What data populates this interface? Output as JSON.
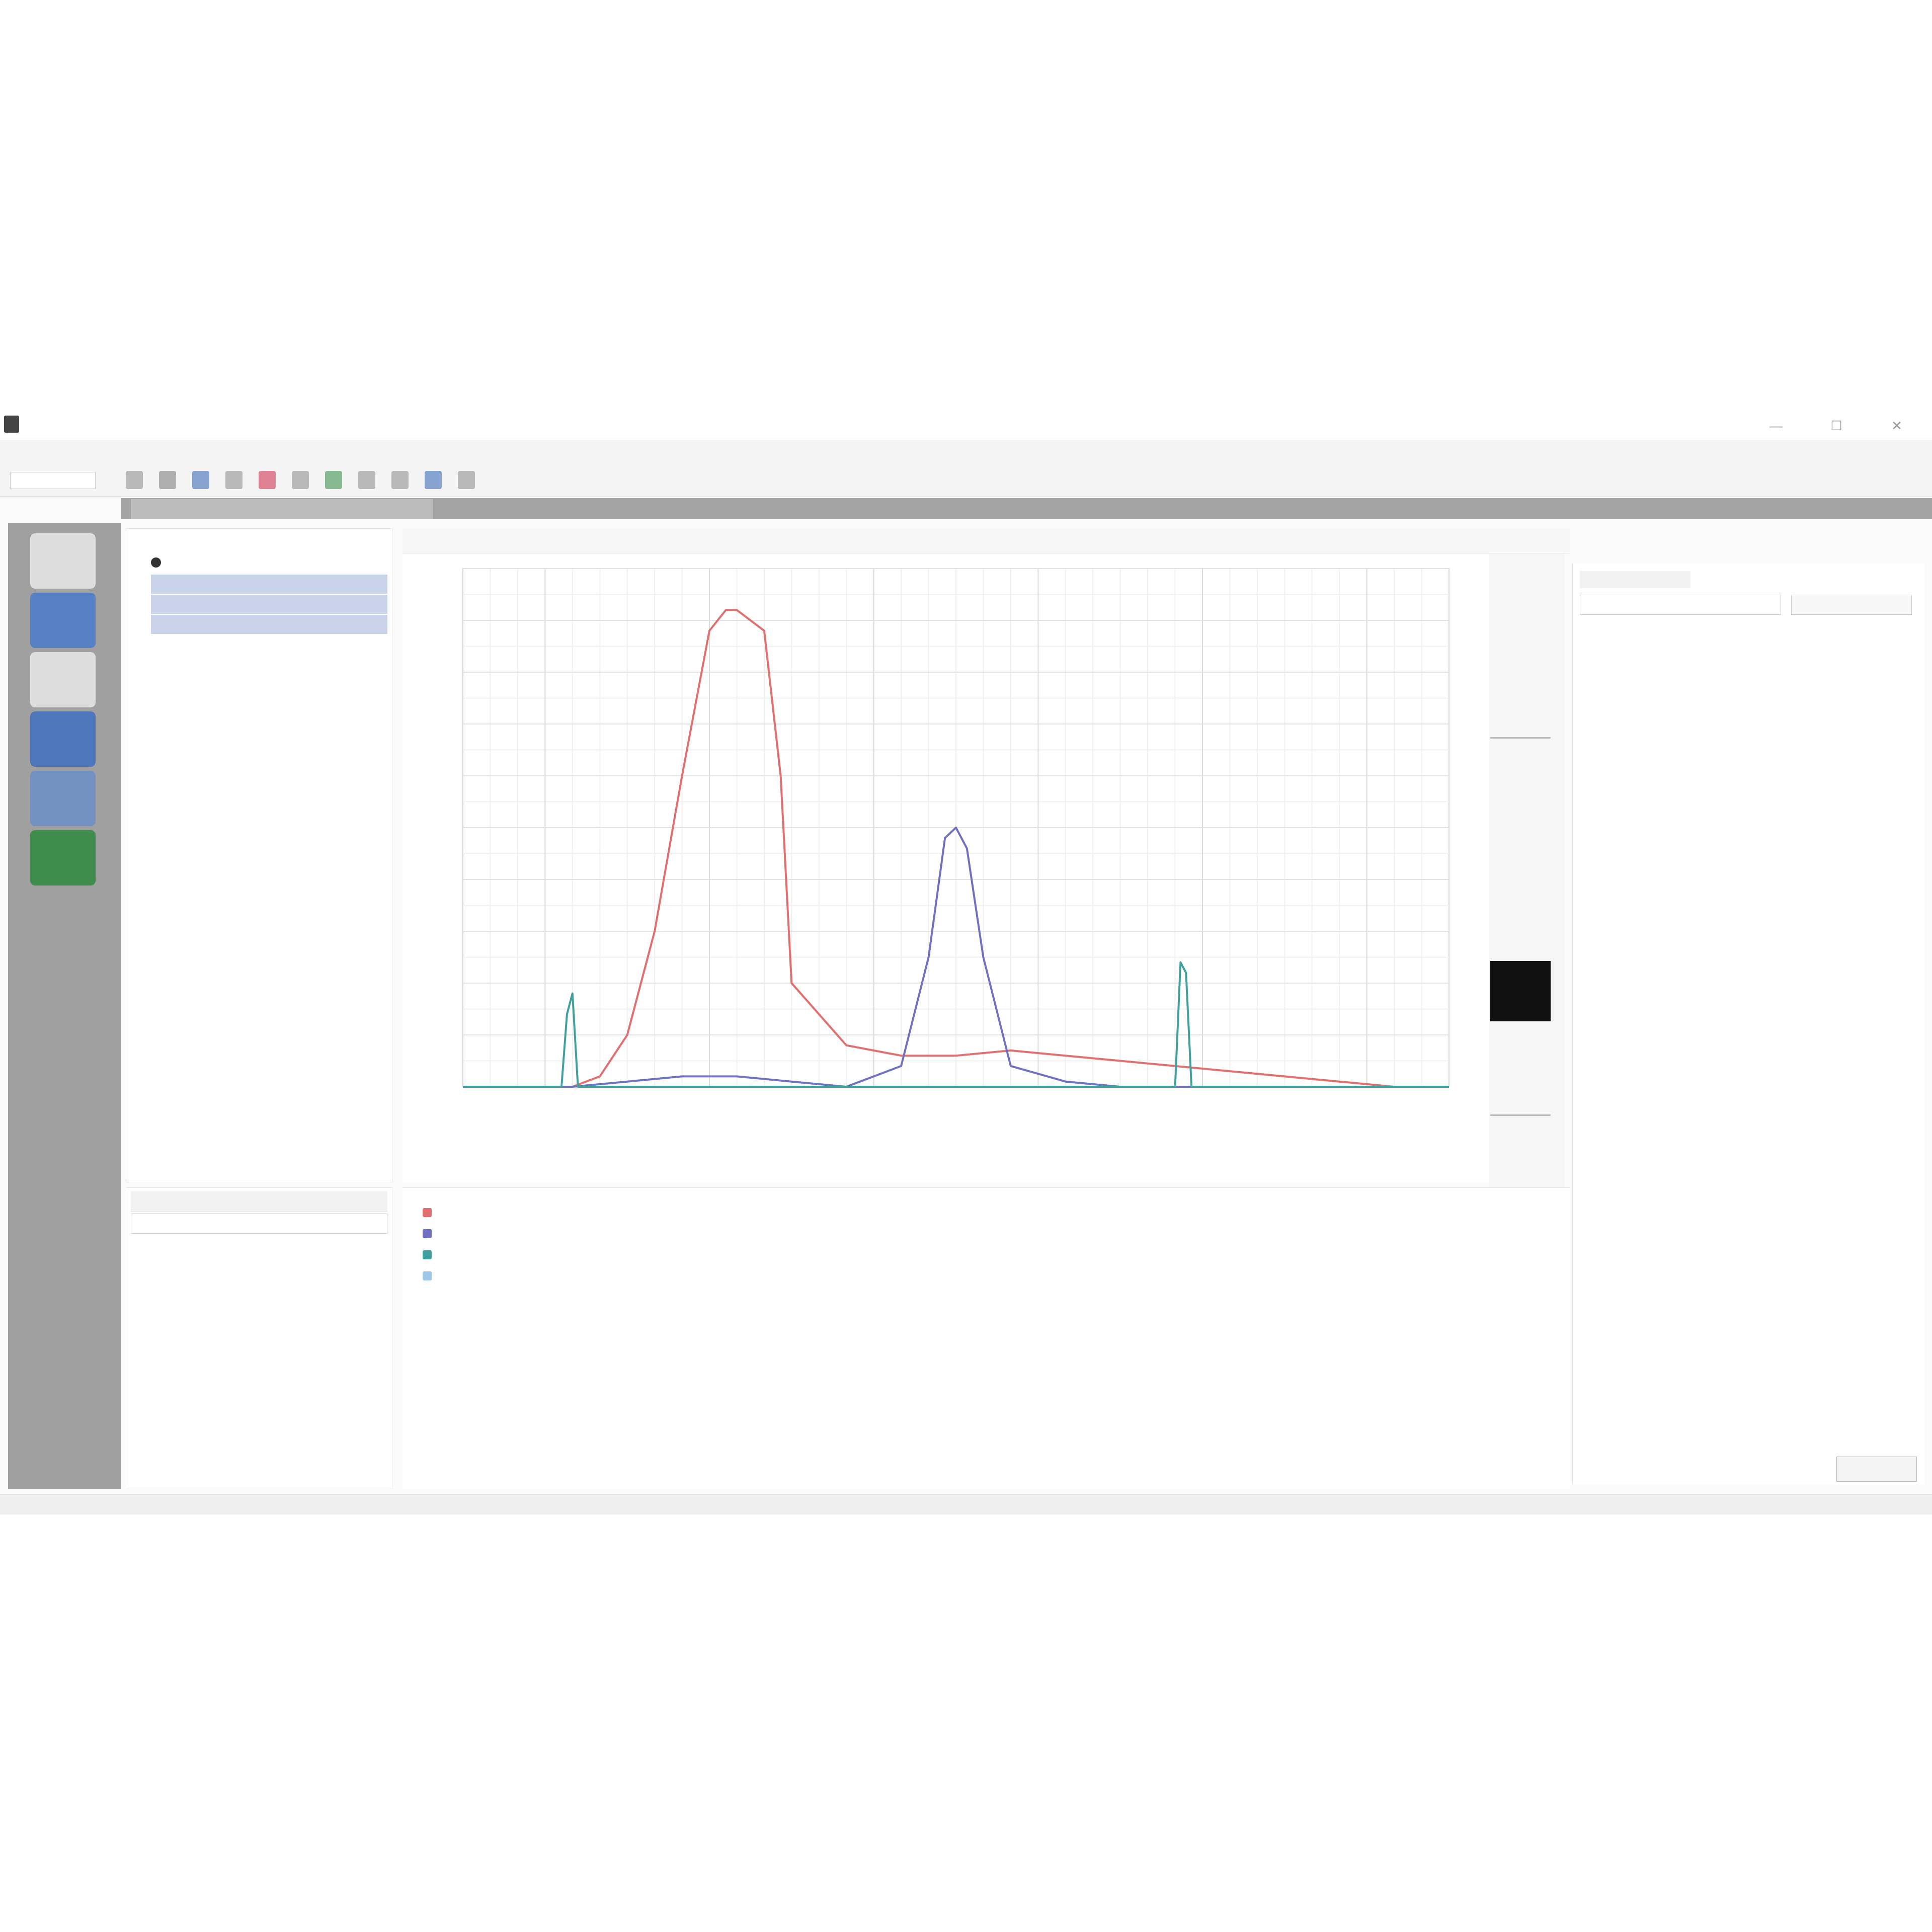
{
  "window": {
    "title": "",
    "controls": {
      "minimize": "—",
      "maximize": "☐",
      "close": "✕"
    }
  },
  "menu": [
    "",
    "",
    "",
    "",
    "",
    ""
  ],
  "toolbar_icons": [
    "open-icon",
    "save-icon",
    "export-icon",
    "zoom-in-icon",
    "zoom-out-icon",
    "fit-icon",
    "cursor-icon",
    "measure-icon",
    "baseline-icon",
    "peak-icon",
    "report-icon"
  ],
  "left_rail": {
    "items": [
      {
        "icon": "document-icon",
        "color": "#e8e8e8"
      },
      {
        "icon": "checkmark-icon",
        "color": "#4a7bc8"
      },
      {
        "icon": "clipboard-icon",
        "color": "#e8e8e8"
      },
      {
        "icon": "chart-icon",
        "color": "#3e6fc0"
      },
      {
        "icon": "globe-icon",
        "color": "#6a8ec8"
      },
      {
        "icon": "cloud-icon",
        "color": "#2e8a3e"
      }
    ]
  },
  "chart_data": {
    "type": "line",
    "title": "",
    "xlabel": "",
    "ylabel": "",
    "y_tick_color": "#e06060",
    "grid": true,
    "series": [
      {
        "color": "#e07070",
        "x": [
          0,
          10,
          20,
          25,
          30,
          35,
          40,
          45,
          48,
          50,
          55,
          58,
          60,
          70,
          80,
          90,
          100,
          110,
          120,
          130,
          140,
          150,
          160,
          170,
          180
        ],
        "y": [
          0,
          0,
          0,
          2,
          10,
          30,
          60,
          88,
          92,
          92,
          88,
          60,
          20,
          8,
          6,
          6,
          7,
          6,
          5,
          4,
          3,
          2,
          1,
          0,
          0
        ]
      },
      {
        "color": "#7070c0",
        "x": [
          0,
          10,
          20,
          30,
          40,
          50,
          60,
          70,
          80,
          85,
          88,
          90,
          92,
          95,
          100,
          110,
          120,
          140,
          160,
          180
        ],
        "y": [
          0,
          0,
          0,
          1,
          2,
          2,
          1,
          0,
          4,
          25,
          48,
          50,
          46,
          25,
          4,
          1,
          0,
          0,
          0,
          0
        ]
      },
      {
        "color": "#40a0a0",
        "x": [
          0,
          18,
          19,
          20,
          21,
          30,
          60,
          100,
          130,
          131,
          132,
          133,
          150,
          180
        ],
        "y": [
          0,
          0,
          14,
          18,
          0,
          0,
          0,
          0,
          0,
          24,
          22,
          0,
          0,
          0
        ]
      }
    ],
    "xlim": [
      0,
      180
    ],
    "ylim": [
      0,
      100
    ],
    "x_ticks": [
      "",
      "",
      "",
      "",
      "",
      ""
    ],
    "y_ticks": [
      "",
      "",
      "",
      "",
      "",
      "",
      "",
      "",
      "",
      "",
      ""
    ]
  },
  "legend": [
    {
      "color": "#e07070",
      "label": ""
    },
    {
      "color": "#7070c0",
      "label": ""
    },
    {
      "color": "#40a0a0",
      "label": ""
    },
    {
      "color": "#9ec6e6",
      "label": ""
    }
  ],
  "props": {
    "ok_label": ""
  }
}
